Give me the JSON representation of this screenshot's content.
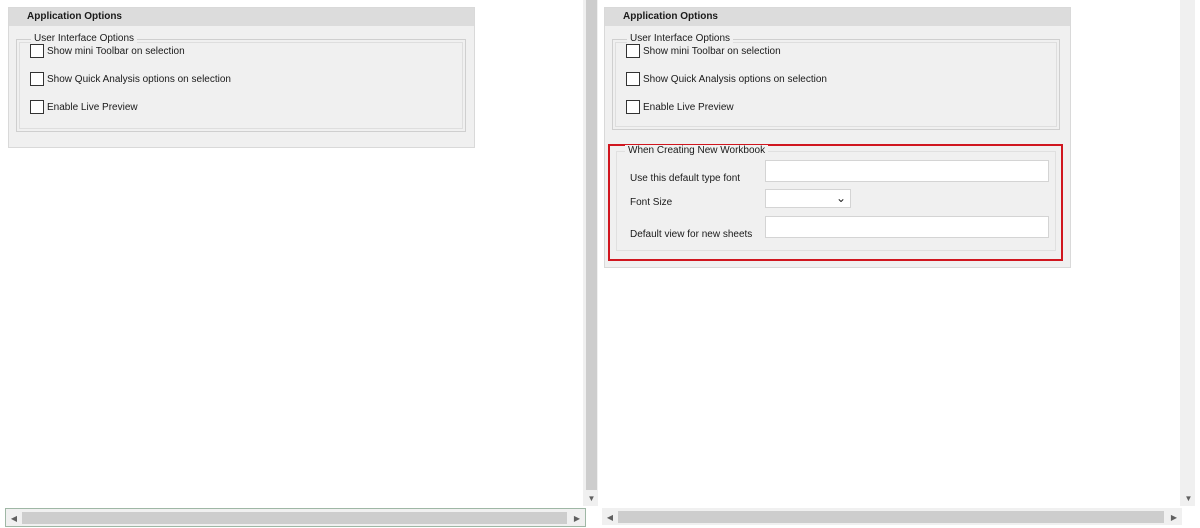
{
  "left_panel": {
    "header": "Application Options",
    "group_title": "User Interface Options",
    "checkboxes": [
      {
        "label": "Show mini Toolbar on selection",
        "checked": false
      },
      {
        "label": "Show Quick Analysis options on selection",
        "checked": false
      },
      {
        "label": "Enable Live Preview",
        "checked": false
      }
    ]
  },
  "right_panel": {
    "header": "Application Options",
    "group_title": "User Interface Options",
    "checkboxes": [
      {
        "label": "Show mini Toolbar on selection",
        "checked": false
      },
      {
        "label": "Show Quick Analysis options on selection",
        "checked": false
      },
      {
        "label": "Enable Live Preview",
        "checked": false
      }
    ],
    "new_workbook": {
      "title": "When Creating New Workbook",
      "font_label": "Use this default type font",
      "font_value": "",
      "size_label": "Font Size",
      "size_value": "",
      "view_label": "Default view for new sheets",
      "view_value": ""
    }
  },
  "icons": {
    "scroll_down": "chevron-down-icon",
    "scroll_left": "chevron-left-icon",
    "scroll_right": "chevron-right-icon",
    "dropdown": "chevron-down-icon"
  },
  "colors": {
    "highlight": "#d0161f",
    "panel_bg": "#f0f0f0",
    "header_bg": "#dcdcdc"
  }
}
